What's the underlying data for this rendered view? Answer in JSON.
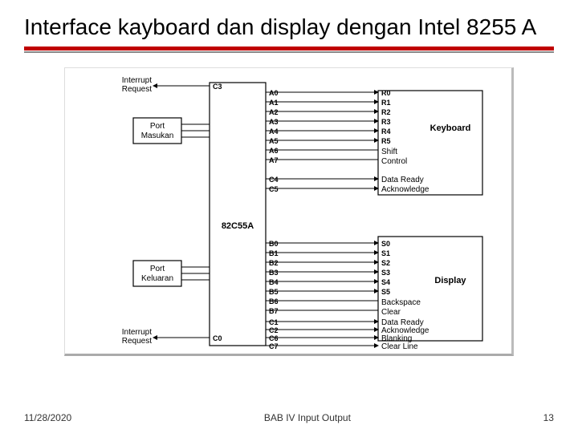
{
  "title": "Interface kayboard dan display dengan Intel 8255 A",
  "footer": {
    "date": "11/28/2020",
    "center": "BAB IV   Input Output",
    "page": "13"
  },
  "diagram": {
    "chipLabel": "82C55A",
    "portIn": "Port\nMasukan",
    "portOut": "Port\nKeluaran",
    "keyboard": "Keyboard",
    "display": "Display",
    "interruptTop": "Interrupt\nRequest",
    "interruptBot": "Interrupt\nRequest",
    "shift": "Shift",
    "control": "Control",
    "dataReady1": "Data Ready",
    "ack1": "Acknowledge",
    "dataReady2": "Data Ready",
    "ack2": "Acknowledge",
    "blanking": "Blanking",
    "clearLine": "Clear Line",
    "backspace": "Backspace",
    "clear": "Clear",
    "A": [
      "A0",
      "A1",
      "A2",
      "A3",
      "A4",
      "A5",
      "A6",
      "A7"
    ],
    "B": [
      "B0",
      "B1",
      "B2",
      "B3",
      "B4",
      "B5",
      "B6",
      "B7"
    ],
    "Cupper": [
      "C3",
      "C4",
      "C5"
    ],
    "Clower": [
      "C0",
      "C1",
      "C2",
      "C6",
      "C7"
    ],
    "R": [
      "R0",
      "R1",
      "R2",
      "R3",
      "R4",
      "R5"
    ],
    "S": [
      "S0",
      "S1",
      "S2",
      "S3",
      "S4",
      "S5"
    ]
  }
}
